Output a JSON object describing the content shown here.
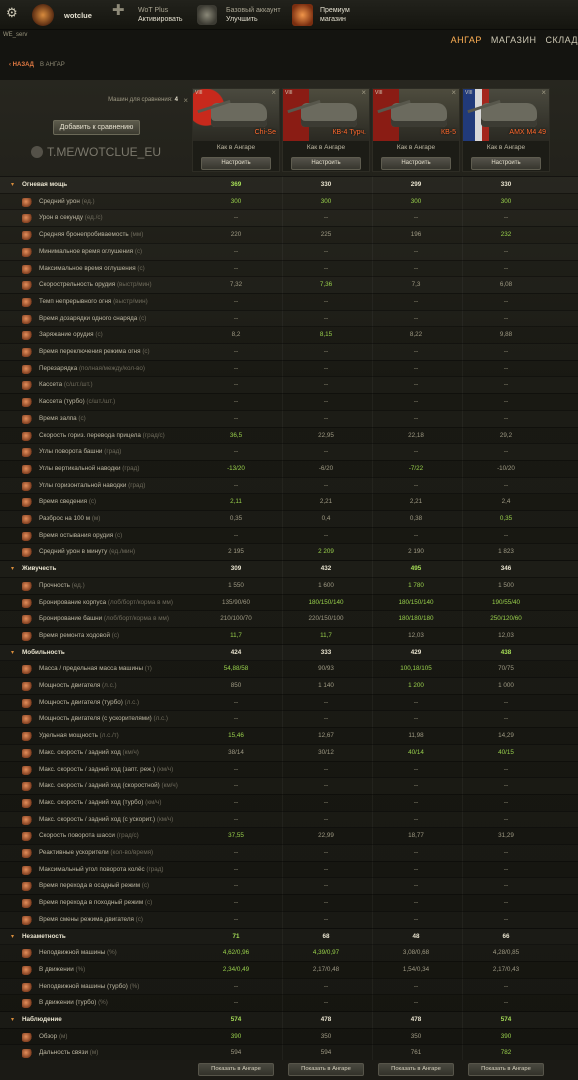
{
  "top": {
    "user": "wotclue",
    "wotplus": "WoT Plus",
    "wotplus_action": "Активировать",
    "basic": "Базовый аккаунт",
    "basic_action": "Улучшить",
    "premium1": "Премиум",
    "premium2": "магазин"
  },
  "server": "WE_serv",
  "nav": [
    "АНГАР",
    "МАГАЗИН",
    "СКЛАД"
  ],
  "back": {
    "btn": "НАЗАД",
    "crumb": "В АНГАР"
  },
  "compare": {
    "count_label": "Машин для сравнения:",
    "count": "4",
    "add_btn": "Добавить к сравнению"
  },
  "watermark": "T.ME/WOTCLUE_EU",
  "tanks": [
    {
      "tier": "VIII",
      "name": "Chi-Se",
      "status": "Как в Ангаре",
      "btn": "Настроить"
    },
    {
      "tier": "VIII",
      "name": "КВ-4 Турч.",
      "status": "Как в Ангаре",
      "btn": "Настроить"
    },
    {
      "tier": "VIII",
      "name": "КВ-5",
      "status": "Как в Ангаре",
      "btn": "Настроить"
    },
    {
      "tier": "VIII",
      "name": "AMX M4 49",
      "status": "Как в Ангаре",
      "btn": "Настроить"
    }
  ],
  "rows": [
    {
      "s": 1,
      "l": "Огневая мощь",
      "v": [
        "369",
        "330",
        "299",
        "330"
      ],
      "g": [
        0
      ]
    },
    {
      "l": "Средний урон",
      "u": "(ед.)",
      "v": [
        "300",
        "300",
        "300",
        "300"
      ],
      "g": [
        0,
        1,
        2,
        3
      ]
    },
    {
      "l": "Урон в секунду",
      "u": "(ед./с)",
      "v": [
        "--",
        "--",
        "--",
        "--"
      ]
    },
    {
      "l": "Средняя бронепробиваемость",
      "u": "(мм)",
      "v": [
        "220",
        "225",
        "196",
        "232"
      ],
      "g": [
        3
      ]
    },
    {
      "l": "Минимальное время оглушения",
      "u": "(с)",
      "v": [
        "--",
        "--",
        "--",
        "--"
      ]
    },
    {
      "l": "Максимальное время оглушения",
      "u": "(с)",
      "v": [
        "--",
        "--",
        "--",
        "--"
      ]
    },
    {
      "l": "Скорострельность орудия",
      "u": "(выстр/мин)",
      "v": [
        "7,32",
        "7,36",
        "7,3",
        "6,08"
      ],
      "g": [
        1
      ]
    },
    {
      "l": "Темп непрерывного огня",
      "u": "(выстр/мин)",
      "v": [
        "--",
        "--",
        "--",
        "--"
      ]
    },
    {
      "l": "Время дозарядки одного снаряда",
      "u": "(с)",
      "v": [
        "--",
        "--",
        "--",
        "--"
      ]
    },
    {
      "l": "Заряжание орудия",
      "u": "(с)",
      "v": [
        "8,2",
        "8,15",
        "8,22",
        "9,88"
      ],
      "g": [
        1
      ]
    },
    {
      "l": "Время переключения режима огня",
      "u": "(с)",
      "v": [
        "--",
        "--",
        "--",
        "--"
      ]
    },
    {
      "l": "Перезарядка",
      "u": "(полная/между/кол-во)",
      "v": [
        "--",
        "--",
        "--",
        "--"
      ]
    },
    {
      "l": "Кассета",
      "u": "(с/шт./шт.)",
      "v": [
        "--",
        "--",
        "--",
        "--"
      ]
    },
    {
      "l": "Кассета (турбо)",
      "u": "(с/шт./шт.)",
      "v": [
        "--",
        "--",
        "--",
        "--"
      ]
    },
    {
      "l": "Время залпа",
      "u": "(с)",
      "v": [
        "--",
        "--",
        "--",
        "--"
      ]
    },
    {
      "l": "Скорость гориз. перевода прицела",
      "u": "(град/с)",
      "v": [
        "36,5",
        "22,95",
        "22,18",
        "29,2"
      ],
      "g": [
        0
      ]
    },
    {
      "l": "Углы поворота башни",
      "u": "(град)",
      "v": [
        "--",
        "--",
        "--",
        "--"
      ]
    },
    {
      "l": "Углы вертикальной наводки",
      "u": "(град)",
      "v": [
        "-13/20",
        "-6/20",
        "-7/22",
        "-10/20"
      ],
      "g": [
        0,
        2
      ]
    },
    {
      "l": "Углы горизонтальной наводки",
      "u": "(град)",
      "v": [
        "--",
        "--",
        "--",
        "--"
      ]
    },
    {
      "l": "Время сведения",
      "u": "(с)",
      "v": [
        "2,11",
        "2,21",
        "2,21",
        "2,4"
      ],
      "g": [
        0
      ]
    },
    {
      "l": "Разброс на 100 м",
      "u": "(м)",
      "v": [
        "0,35",
        "0,4",
        "0,38",
        "0,35"
      ],
      "g": [
        3
      ]
    },
    {
      "l": "Время остывания орудия",
      "u": "(с)",
      "v": [
        "--",
        "--",
        "--",
        "--"
      ]
    },
    {
      "l": "Средний урон в минуту",
      "u": "(ед./мин)",
      "v": [
        "2 195",
        "2 209",
        "2 190",
        "1 823"
      ],
      "g": [
        1
      ]
    },
    {
      "s": 1,
      "l": "Живучесть",
      "v": [
        "309",
        "432",
        "495",
        "346"
      ],
      "g": [
        2
      ]
    },
    {
      "l": "Прочность",
      "u": "(ед.)",
      "v": [
        "1 550",
        "1 600",
        "1 780",
        "1 500"
      ],
      "g": [
        2
      ]
    },
    {
      "l": "Бронирование корпуса",
      "u": "(лоб/борт/корма в мм)",
      "v": [
        "135/90/60",
        "180/150/140",
        "180/150/140",
        "190/55/40"
      ],
      "g": [
        1,
        2,
        3
      ]
    },
    {
      "l": "Бронирование башни",
      "u": "(лоб/борт/корма в мм)",
      "v": [
        "210/100/70",
        "220/150/100",
        "180/180/180",
        "250/120/60"
      ],
      "g": [
        2,
        3
      ]
    },
    {
      "l": "Время ремонта ходовой",
      "u": "(с)",
      "v": [
        "11,7",
        "11,7",
        "12,03",
        "12,03"
      ],
      "g": [
        0,
        1
      ]
    },
    {
      "s": 1,
      "l": "Мобильность",
      "v": [
        "424",
        "333",
        "429",
        "438"
      ],
      "g": [
        3
      ]
    },
    {
      "l": "Масса / предельная масса машины",
      "u": "(т)",
      "v": [
        "54,88/58",
        "90/93",
        "100,18/105",
        "70/75"
      ],
      "g": [
        0,
        2
      ]
    },
    {
      "l": "Мощность двигателя",
      "u": "(л.с.)",
      "v": [
        "850",
        "1 140",
        "1 200",
        "1 000"
      ],
      "g": [
        2
      ]
    },
    {
      "l": "Мощность двигателя (турбо)",
      "u": "(л.с.)",
      "v": [
        "--",
        "--",
        "--",
        "--"
      ]
    },
    {
      "l": "Мощность двигателя (с ускорителями)",
      "u": "(л.с.)",
      "v": [
        "--",
        "--",
        "--",
        "--"
      ]
    },
    {
      "l": "Удельная мощность",
      "u": "(л.с./т)",
      "v": [
        "15,46",
        "12,67",
        "11,98",
        "14,29"
      ],
      "g": [
        0
      ]
    },
    {
      "l": "Макс. скорость / задний ход",
      "u": "(км/ч)",
      "v": [
        "38/14",
        "30/12",
        "40/14",
        "40/15"
      ],
      "g": [
        2,
        3
      ]
    },
    {
      "l": "Макс. скорость / задний ход (запт. реж.)",
      "u": "(км/ч)",
      "v": [
        "--",
        "--",
        "--",
        "--"
      ]
    },
    {
      "l": "Макс. скорость / задний ход (скоростной)",
      "u": "(км/ч)",
      "v": [
        "--",
        "--",
        "--",
        "--"
      ]
    },
    {
      "l": "Макс. скорость / задний ход (турбо)",
      "u": "(км/ч)",
      "v": [
        "--",
        "--",
        "--",
        "--"
      ]
    },
    {
      "l": "Макс. скорость / задний ход (с ускорит.)",
      "u": "(км/ч)",
      "v": [
        "--",
        "--",
        "--",
        "--"
      ]
    },
    {
      "l": "Скорость поворота шасси",
      "u": "(град/с)",
      "v": [
        "37,55",
        "22,99",
        "18,77",
        "31,29"
      ],
      "g": [
        0
      ]
    },
    {
      "l": "Реактивные ускорители",
      "u": "(кол-во/время)",
      "v": [
        "--",
        "--",
        "--",
        "--"
      ]
    },
    {
      "l": "Максимальный угол поворота колёс",
      "u": "(град)",
      "v": [
        "--",
        "--",
        "--",
        "--"
      ]
    },
    {
      "l": "Время перехода в осадный режим",
      "u": "(с)",
      "v": [
        "--",
        "--",
        "--",
        "--"
      ]
    },
    {
      "l": "Время перехода в походный режим",
      "u": "(с)",
      "v": [
        "--",
        "--",
        "--",
        "--"
      ]
    },
    {
      "l": "Время смены режима двигателя",
      "u": "(с)",
      "v": [
        "--",
        "--",
        "--",
        "--"
      ]
    },
    {
      "s": 1,
      "l": "Незаметность",
      "v": [
        "71",
        "68",
        "48",
        "66"
      ],
      "g": [
        0
      ]
    },
    {
      "l": "Неподвижной машины",
      "u": "(%)",
      "v": [
        "4,62/0,96",
        "4,39/0,97",
        "3,08/0,68",
        "4,28/0,85"
      ],
      "g": [
        0,
        1
      ]
    },
    {
      "l": "В движении",
      "u": "(%)",
      "v": [
        "2,34/0,49",
        "2,17/0,48",
        "1,54/0,34",
        "2,17/0,43"
      ],
      "g": [
        0
      ]
    },
    {
      "l": "Неподвижной машины (турбо)",
      "u": "(%)",
      "v": [
        "--",
        "--",
        "--",
        "--"
      ]
    },
    {
      "l": "В движении (турбо)",
      "u": "(%)",
      "v": [
        "--",
        "--",
        "--",
        "--"
      ]
    },
    {
      "s": 1,
      "l": "Наблюдение",
      "v": [
        "574",
        "478",
        "478",
        "574"
      ],
      "g": [
        0,
        3
      ]
    },
    {
      "l": "Обзор",
      "u": "(м)",
      "v": [
        "390",
        "350",
        "350",
        "390"
      ],
      "g": [
        0,
        3
      ]
    },
    {
      "l": "Дальность связи",
      "u": "(м)",
      "v": [
        "594",
        "594",
        "761",
        "782"
      ],
      "g": [
        3
      ]
    }
  ],
  "footer_btn": "Показать в Ангаре"
}
